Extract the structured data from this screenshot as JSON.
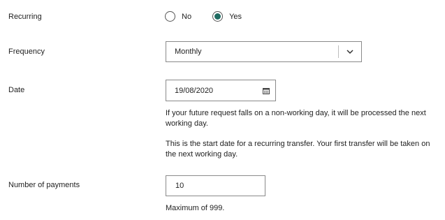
{
  "recurring": {
    "label": "Recurring",
    "options": [
      {
        "label": "No",
        "checked": false
      },
      {
        "label": "Yes",
        "checked": true
      }
    ]
  },
  "frequency": {
    "label": "Frequency",
    "value": "Monthly"
  },
  "date": {
    "label": "Date",
    "value": "19/08/2020",
    "hint_1": "If your future request falls on a non-working day, it will be processed the next working day.",
    "hint_2": "This is the start date for a recurring transfer. Your first transfer will be taken on the next working day."
  },
  "payments": {
    "label": "Number of payments",
    "value": "10",
    "hint": "Maximum of 999."
  },
  "colors": {
    "accent": "#1f6b62",
    "border": "#8a8a8a",
    "text": "#222222"
  }
}
